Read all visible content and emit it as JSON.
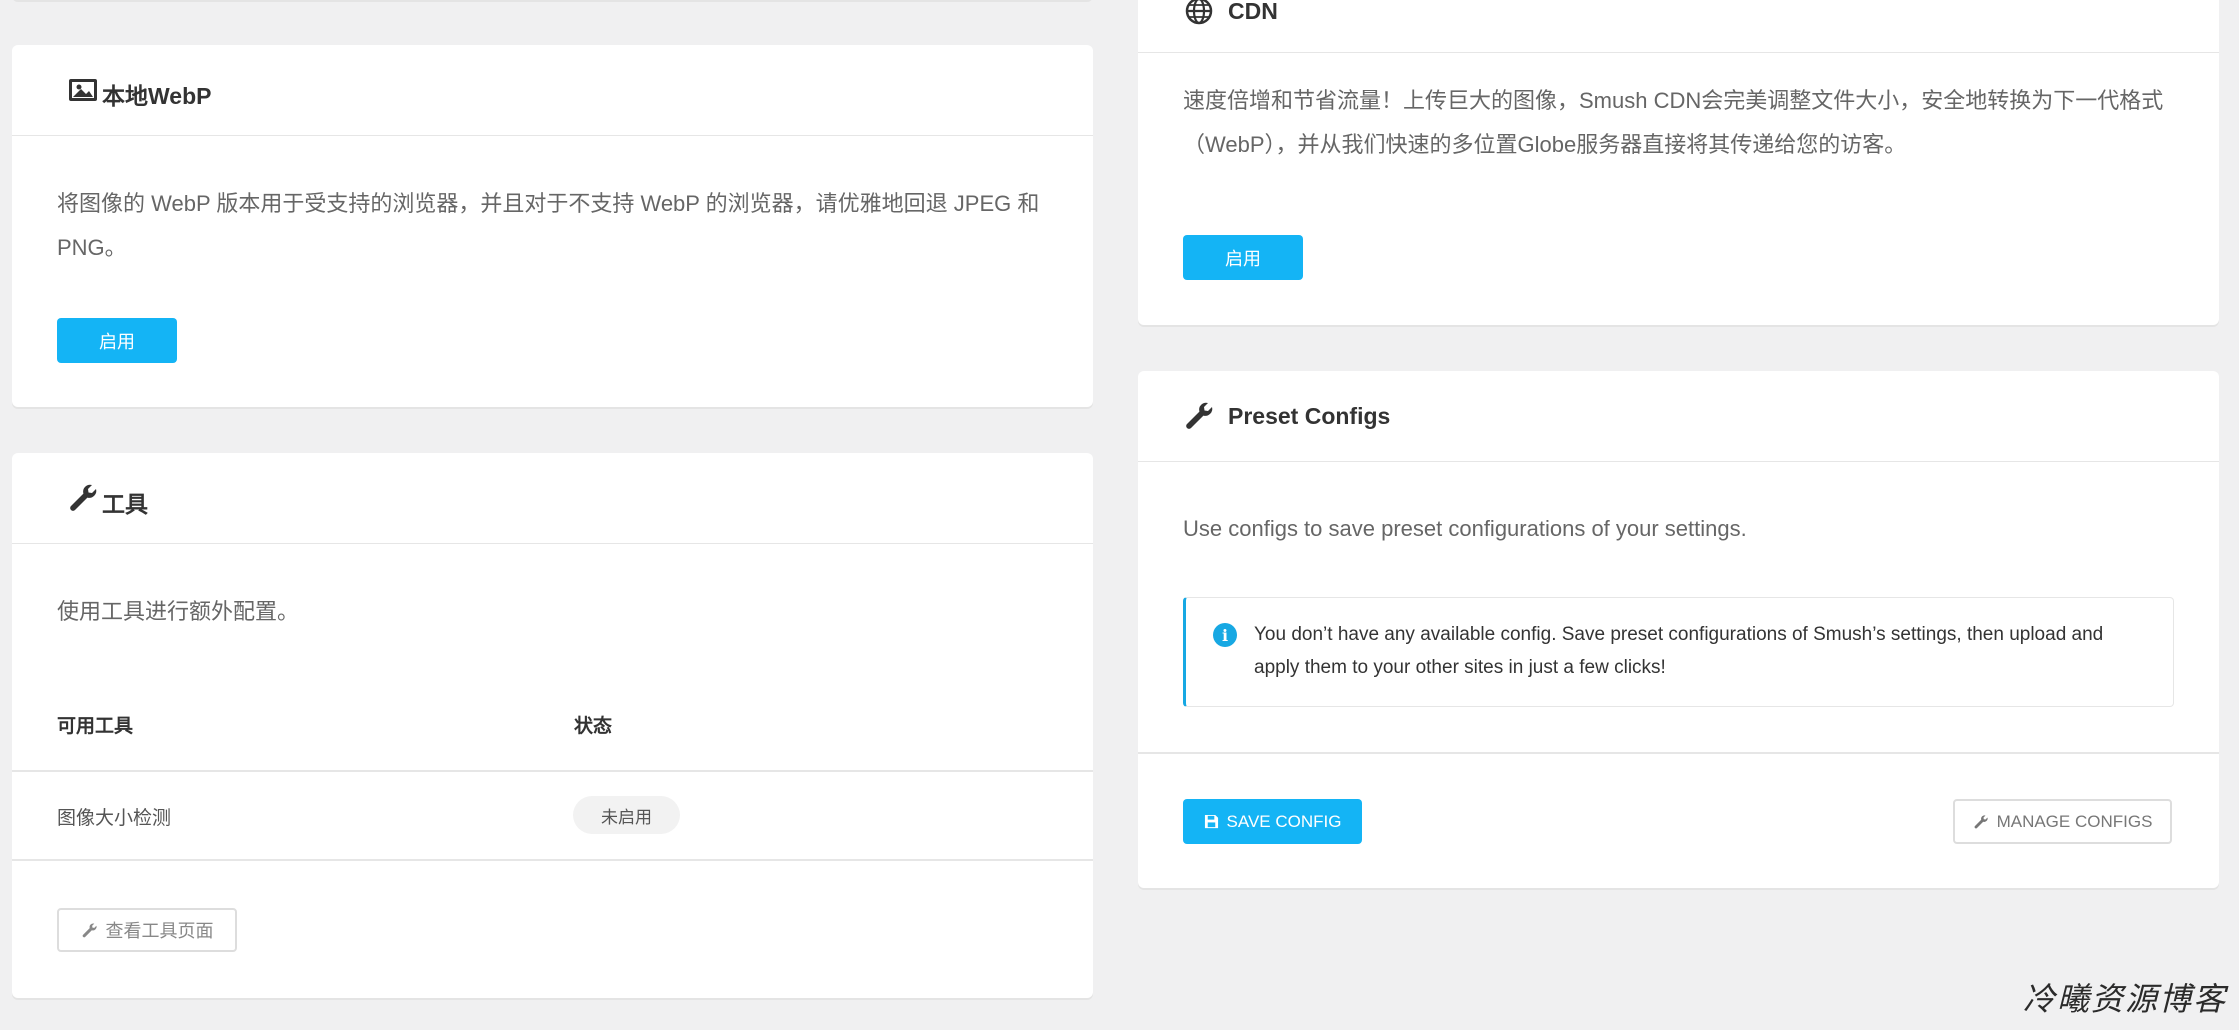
{
  "colors": {
    "accent": "#14b4f5",
    "page_bg": "#f0f0f1",
    "card_bg": "#ffffff"
  },
  "webp": {
    "title": "本地WebP",
    "icon": "image-icon",
    "description": "将图像的 WebP 版本用于受支持的浏览器，并且对于不支持 WebP 的浏览器，请优雅地回退 JPEG 和 PNG。",
    "enable_label": "启用"
  },
  "tools": {
    "title": "工具",
    "icon": "wrench-icon",
    "description": "使用工具进行额外配置。",
    "columns": [
      "可用工具",
      "状态"
    ],
    "rows": [
      {
        "name": "图像大小检测",
        "status": "未启用"
      }
    ],
    "view_button_label": "查看工具页面"
  },
  "cdn": {
    "title": "CDN",
    "icon": "globe-icon",
    "description": "速度倍增和节省流量！上传巨大的图像，Smush CDN会完美调整文件大小，安全地转换为下一代格式（WebP），并从我们快速的多位置Globe服务器直接将其传递给您的访客。",
    "enable_label": "启用"
  },
  "preset": {
    "title": "Preset Configs",
    "icon": "wrench-icon",
    "description": "Use configs to save preset configurations of your settings.",
    "notice": "You don’t have any available config. Save preset configurations of Smush’s settings, then upload and apply them to your other sites in just a few clicks!",
    "save_label": "SAVE CONFIG",
    "manage_label": "MANAGE CONFIGS"
  },
  "watermark": "冷曦资源博客"
}
